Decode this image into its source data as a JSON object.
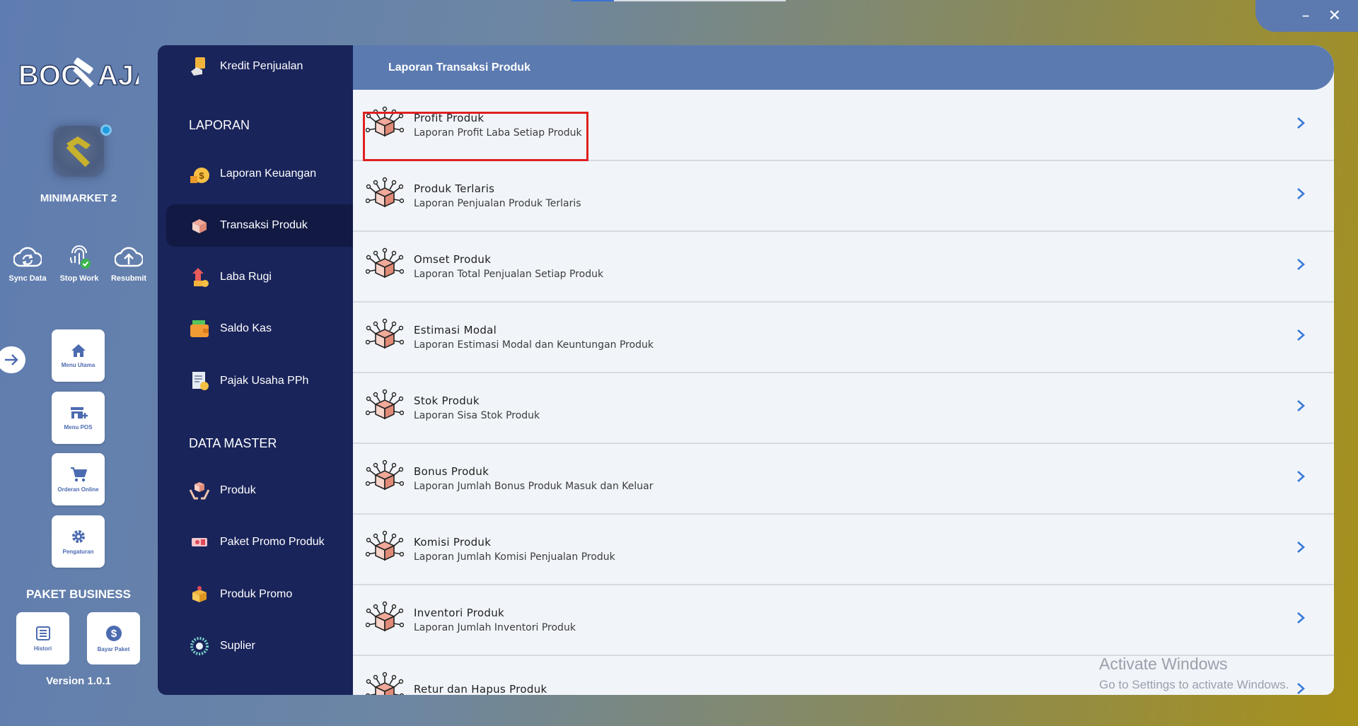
{
  "window": {
    "minimize_label": "–",
    "close_label": "✕"
  },
  "rail": {
    "logo_text": "BOC AJA",
    "store_name": "MINIMARKET 2",
    "quick_actions": [
      {
        "label": "Sync Data",
        "icon": "sync-cloud-icon"
      },
      {
        "label": "Stop Work",
        "icon": "fingerprint-icon"
      },
      {
        "label": "Resubmit",
        "icon": "cloud-upload-icon"
      }
    ],
    "tiles": [
      {
        "label": "Menu Utama",
        "icon": "home-icon"
      },
      {
        "label": "Menu POS",
        "icon": "store-add-icon"
      },
      {
        "label": "Orderan Online",
        "icon": "cart-icon"
      },
      {
        "label": "Pengaturan",
        "icon": "gear-icon"
      }
    ],
    "package_title": "PAKET BUSINESS",
    "package_tiles": [
      {
        "label": "Histori",
        "icon": "list-icon"
      },
      {
        "label": "Bayar Paket",
        "icon": "dollar-icon"
      }
    ],
    "version": "Version 1.0.1"
  },
  "nav": {
    "top_item": "Kredit Penjualan",
    "section_laporan": "LAPORAN",
    "laporan_items": [
      {
        "label": "Laporan Keuangan",
        "icon": "money-bag-icon"
      },
      {
        "label": "Transaksi Produk",
        "icon": "product-box-icon",
        "active": true
      },
      {
        "label": "Laba Rugi",
        "icon": "profit-arrow-icon"
      },
      {
        "label": "Saldo Kas",
        "icon": "wallet-icon"
      },
      {
        "label": "Pajak Usaha PPh",
        "icon": "tax-document-icon"
      }
    ],
    "section_master": "DATA MASTER",
    "master_items": [
      {
        "label": "Produk",
        "icon": "product-hands-icon"
      },
      {
        "label": "Paket Promo Produk",
        "icon": "promo-ticket-icon"
      },
      {
        "label": "Produk Promo",
        "icon": "promo-box-icon"
      },
      {
        "label": "Suplier",
        "icon": "supplier-icon"
      }
    ]
  },
  "main": {
    "header_title": "Laporan Transaksi Produk",
    "reports": [
      {
        "title": "Profit Produk",
        "subtitle": "Laporan Profit Laba Setiap Produk"
      },
      {
        "title": "Produk Terlaris",
        "subtitle": "Laporan Penjualan Produk Terlaris"
      },
      {
        "title": "Omset Produk",
        "subtitle": "Laporan Total Penjualan Setiap Produk"
      },
      {
        "title": "Estimasi Modal",
        "subtitle": "Laporan Estimasi Modal dan Keuntungan Produk"
      },
      {
        "title": "Stok Produk",
        "subtitle": "Laporan Sisa Stok Produk"
      },
      {
        "title": "Bonus Produk",
        "subtitle": "Laporan Jumlah Bonus Produk Masuk dan Keluar"
      },
      {
        "title": "Komisi Produk",
        "subtitle": "Laporan Jumlah Komisi Penjualan Produk"
      },
      {
        "title": "Inventori Produk",
        "subtitle": "Laporan Jumlah Inventori Produk"
      },
      {
        "title": "Retur dan Hapus Produk",
        "subtitle": ""
      }
    ]
  },
  "watermark": {
    "line1": "Activate Windows",
    "line2": "Go to Settings to activate Windows."
  },
  "colors": {
    "nav_bg": "#19245a",
    "header_bg": "#5b7ab0",
    "accent_blue": "#3a7ad6",
    "highlight_red": "#e02020"
  }
}
